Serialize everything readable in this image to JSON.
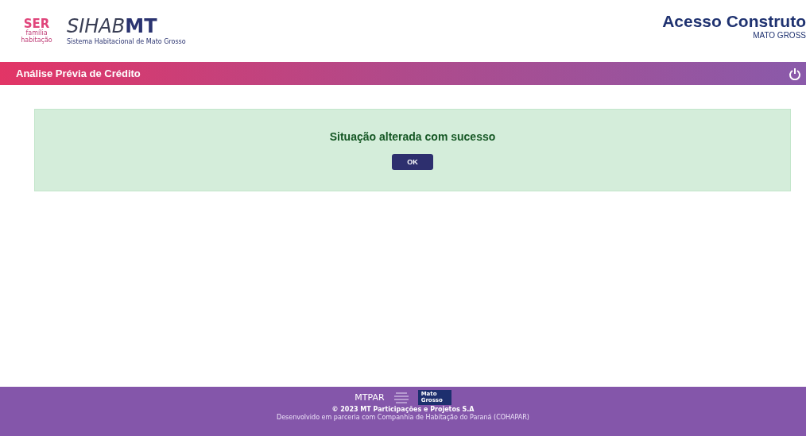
{
  "header": {
    "ser_logo": {
      "mark": "SER",
      "tagline": "família habitação"
    },
    "sihab_logo": {
      "light": "SIHAB",
      "bold": "MT",
      "subtitle": "Sistema Habitacional de Mato Grosso"
    },
    "portal": {
      "title": "Acesso Construto",
      "subtitle": "MATO GROSS"
    }
  },
  "title_bar": {
    "title": "Análise Prévia de Crédito"
  },
  "alert": {
    "message": "Situação alterada com sucesso",
    "button": "OK"
  },
  "footer": {
    "mtpar_logo": "MTPAR",
    "state_logo": "Mato Grosso",
    "copyright": "© 2023 MT Participações e Projetos S.A",
    "credit": "Desenvolvido em parceria com Companhia de Habitação do Paraná (COHAPAR)"
  }
}
